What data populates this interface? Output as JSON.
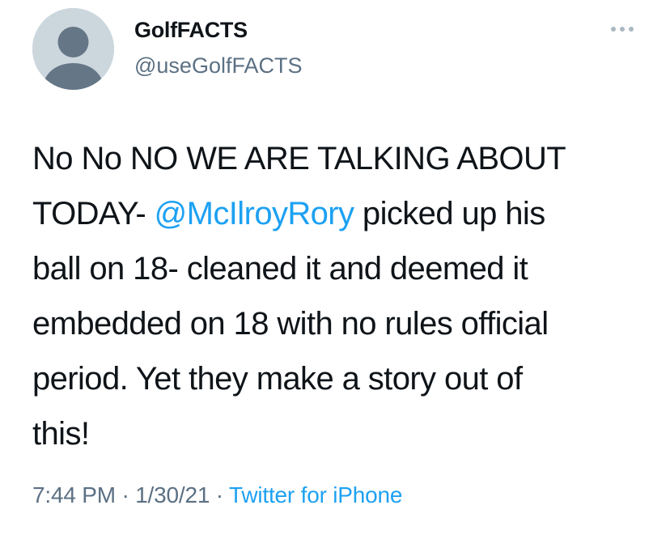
{
  "user": {
    "display_name": "GolfFACTS",
    "handle": "@useGolfFACTS",
    "avatar_icon": "default-avatar-icon"
  },
  "more_icon": "more-options-icon",
  "tweet": {
    "line1": "No No NO WE ARE TALKING ABOUT",
    "line2_before": "TODAY- ",
    "mention": "@McIlroyRory",
    "line2_after": " picked up his",
    "line3": "ball on 18- cleaned it and deemed it",
    "line4": "embedded on 18 with no rules official",
    "line5": "period. Yet they make a story out of",
    "line6": "this!"
  },
  "meta": {
    "time": "7:44 PM",
    "separator1": " · ",
    "date": "1/30/21",
    "separator2": " · ",
    "source": "Twitter for iPhone"
  },
  "colors": {
    "link": "#1da1f2",
    "secondary_text": "#5b7083",
    "avatar_bg": "#ccd6dd",
    "avatar_figure": "#657786"
  }
}
